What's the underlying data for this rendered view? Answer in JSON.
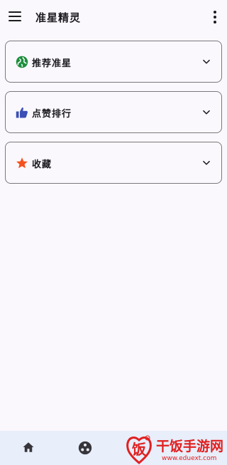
{
  "app": {
    "title": "准星精灵"
  },
  "cards": [
    {
      "label": "推荐准星",
      "icon": "globe-icon",
      "icon_color": "#1e8e3e"
    },
    {
      "label": "点赞排行",
      "icon": "thumbs-up-icon",
      "icon_color": "#3b4fb5"
    },
    {
      "label": "收藏",
      "icon": "star-icon",
      "icon_color": "#f4511e"
    }
  ],
  "bottom_nav": {
    "items": [
      "home-icon",
      "explore-icon"
    ]
  },
  "watermark": {
    "text": "干饭手游网",
    "url": "www.eduext.com"
  },
  "colors": {
    "background": "#fbf8fd",
    "bottom_bar": "#e8eefa",
    "card_border": "#7a777e",
    "watermark": "#e02020"
  }
}
